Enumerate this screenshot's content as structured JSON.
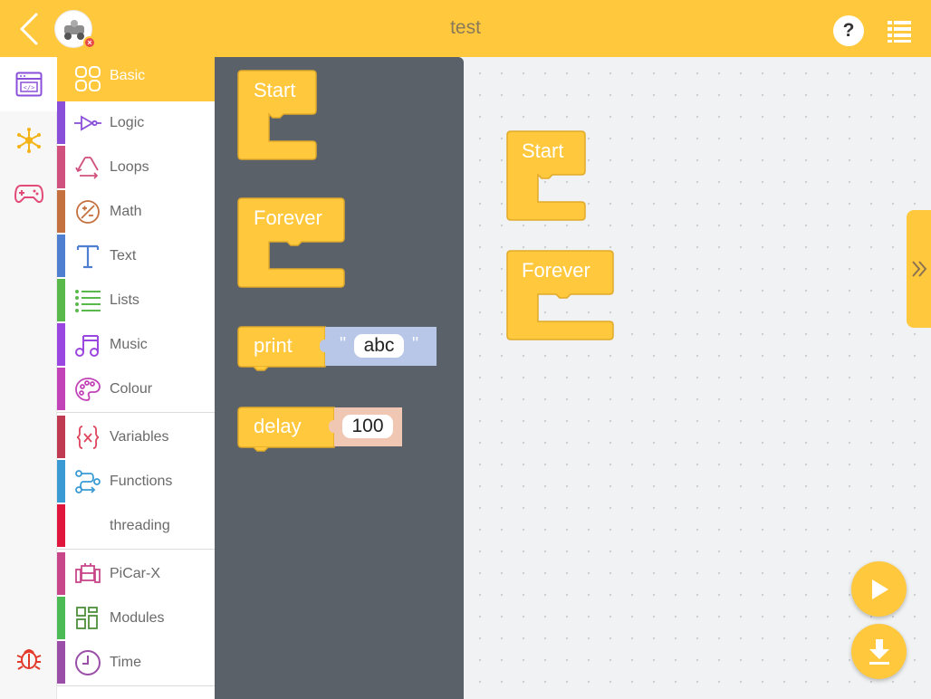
{
  "header": {
    "title": "test",
    "help_label": "?"
  },
  "rail": {
    "items": [
      "code-editor",
      "connections",
      "gamepad",
      "debug"
    ]
  },
  "categories": [
    {
      "label": "Basic",
      "color": "#ffc83d",
      "icon": "basic-grid-icon"
    },
    {
      "label": "Logic",
      "color": "#8a4fd8",
      "icon": "logic-gate-icon"
    },
    {
      "label": "Loops",
      "color": "#d0507e",
      "icon": "loops-recycle-icon"
    },
    {
      "label": "Math",
      "color": "#c4703f",
      "icon": "math-plus-minus-icon"
    },
    {
      "label": "Text",
      "color": "#4e7fd1",
      "icon": "text-t-icon"
    },
    {
      "label": "Lists",
      "color": "#5ab94b",
      "icon": "lists-icon"
    },
    {
      "label": "Music",
      "color": "#9a46e0",
      "icon": "music-note-icon"
    },
    {
      "label": "Colour",
      "color": "#c242b7",
      "icon": "colour-palette-icon"
    },
    {
      "label": "Variables",
      "color": "#c03a52",
      "icon": "variables-braces-icon"
    },
    {
      "label": "Functions",
      "color": "#3a9ad4",
      "icon": "functions-flow-icon"
    },
    {
      "label": "threading",
      "color": "#e0163d",
      "icon": ""
    },
    {
      "label": "PiCar-X",
      "color": "#c8478a",
      "icon": "picar-icon"
    },
    {
      "label": "Modules",
      "color": "#4dbb55",
      "icon": "modules-grid-icon"
    },
    {
      "label": "Time",
      "color": "#9a4ea8",
      "icon": "time-clock-icon"
    }
  ],
  "flyout": {
    "start_label": "Start",
    "forever_label": "Forever",
    "print_label": "print",
    "print_open_quote": "\"",
    "print_value": "abc",
    "print_close_quote": "\"",
    "delay_label": "delay",
    "delay_value": "100"
  },
  "workspace": {
    "start_label": "Start",
    "forever_label": "Forever"
  },
  "colors": {
    "accent": "#ffc83d",
    "block_fill": "#ffc83d",
    "block_stroke": "#e0a92a",
    "flyout_bg": "#5b6169",
    "text_block": "#b8c6e8",
    "math_block": "#efc7b3"
  }
}
